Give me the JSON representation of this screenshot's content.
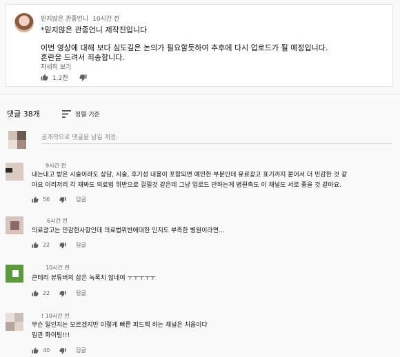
{
  "post": {
    "author": "믿지않은 관종언니",
    "time": "10시간 전",
    "headline": "*믿지않은 관종언니 제작진입니다",
    "body_line1": "이번 영상에 대해 보다 심도깊은 논의가 필요할듯하여 추후에 다시 업로드가 될 예정입니다.",
    "body_line2": "혼란을 드려서 죄송합니다.",
    "more": "자세히 보기",
    "likes": "1.2천"
  },
  "comments_header": {
    "count": "댓글 38개",
    "sort_label": "정렬 기준"
  },
  "add_comment": {
    "placeholder": "공개적으로 댓글을 남길 계정:"
  },
  "comments": [
    {
      "time": "9시간 전",
      "lines": [
        "내는내고 받은 시술이라도 상담, 시술, 후기성 내용이 포함되면 예민한 부분인데 유료광고 표기까지 붙어서 더 민감한 것 같",
        "아요 이리저리 각 재봐도 의료법 위반으로 걸릴것 같은데 그냥 업로드 안하는게 병원측도 이 채널도 서로 좋을 것 같아요."
      ],
      "likes": "56",
      "reply": "답글"
    },
    {
      "time": "6시간 전",
      "lines": [
        "의료광고는 민감한사항인데 의료법위반에대한 인지도 부족한 병원이라면..."
      ],
      "likes": "22",
      "reply": "답글"
    },
    {
      "time": "10시간 전",
      "lines": [
        "큰테리 뷰튜버의 삶은 녹록치 않네여 ㅜㅜㅜㅜㅜ"
      ],
      "likes": "22",
      "reply": "답글"
    },
    {
      "time": "! 10시간 전",
      "lines": [
        "무슨 일인지는 모르겠지만 이렇게 빠른 피드백 하는 채널은 처음이다",
        "밈관 화이팅!!!"
      ],
      "likes": "40",
      "reply": "답글"
    }
  ],
  "colors": {
    "background": "#f9f9f9",
    "card": "#ffffff",
    "secondary_text": "#606060",
    "avatar_green": "#5a9a3c"
  }
}
